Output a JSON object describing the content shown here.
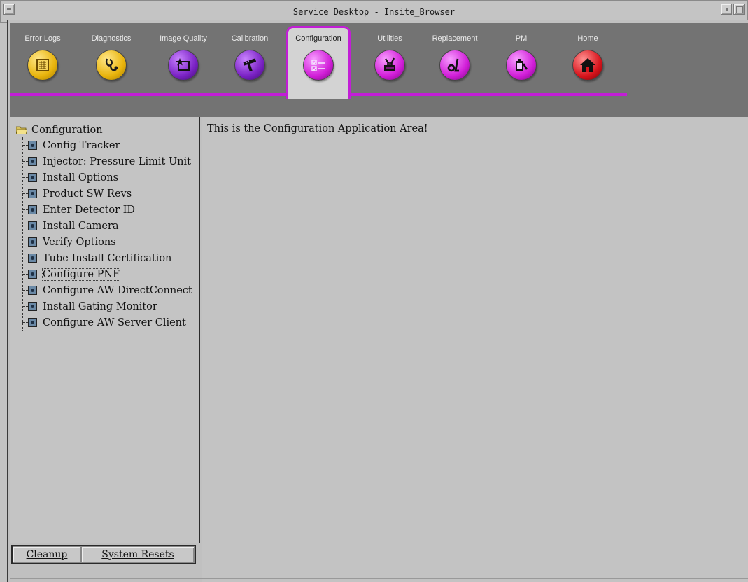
{
  "window": {
    "title": "Service Desktop - Insite_Browser"
  },
  "toolbar": {
    "active_tab": "Configuration",
    "tabs": [
      {
        "label": "Error Logs",
        "icon": "error-logs-icon",
        "color": "#f2c21a"
      },
      {
        "label": "Diagnostics",
        "icon": "stethoscope-icon",
        "color": "#f2c21a"
      },
      {
        "label": "Image Quality",
        "icon": "image-quality-icon",
        "color": "#7a22c4"
      },
      {
        "label": "Calibration",
        "icon": "calibration-icon",
        "color": "#7a22c4"
      },
      {
        "label": "Configuration",
        "icon": "checklist-icon",
        "color": "#d11ed8"
      },
      {
        "label": "Utilities",
        "icon": "toolbox-icon",
        "color": "#d11ed8"
      },
      {
        "label": "Replacement",
        "icon": "wrench-icon",
        "color": "#d11ed8"
      },
      {
        "label": "PM",
        "icon": "pm-icon",
        "color": "#d11ed8"
      },
      {
        "label": "Home",
        "icon": "home-icon",
        "color": "#d8141c"
      }
    ]
  },
  "sidebar": {
    "root_label": "Configuration",
    "items": [
      {
        "label": "Config Tracker"
      },
      {
        "label": "Injector: Pressure Limit Unit"
      },
      {
        "label": "Install Options"
      },
      {
        "label": "Product SW Revs"
      },
      {
        "label": "Enter Detector ID"
      },
      {
        "label": "Install Camera"
      },
      {
        "label": "Verify Options"
      },
      {
        "label": "Tube Install Certification"
      },
      {
        "label": "Configure PNF"
      },
      {
        "label": "Configure AW DirectConnect"
      },
      {
        "label": "Install Gating Monitor"
      },
      {
        "label": "Configure AW Server Client"
      }
    ],
    "focused_item": "Configure PNF",
    "buttons": {
      "cleanup": "Cleanup",
      "system_resets": "System Resets"
    }
  },
  "main": {
    "message": "This is the Configuration Application Area!"
  }
}
